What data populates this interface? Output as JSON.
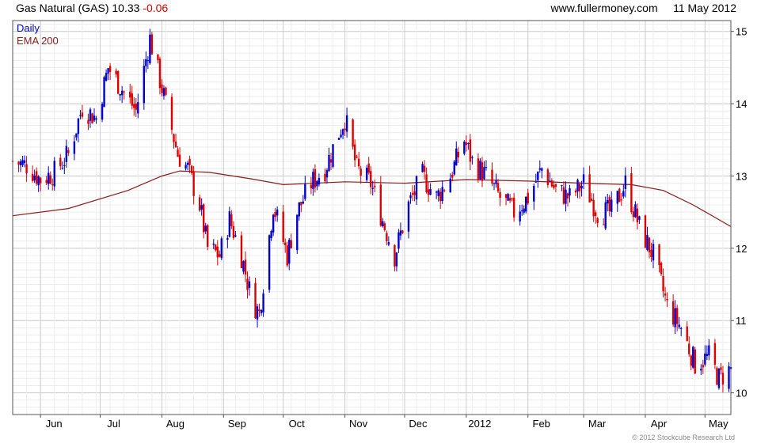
{
  "header": {
    "title": "Gas Natural (GAS)",
    "last_price": "10.33",
    "change": "-0.06",
    "site": "www.fullermoney.com",
    "date": "11 May 2012"
  },
  "copyright": "© 2012 Stockcube Research Ltd",
  "colors": {
    "up": "#0000cc",
    "down": "#dd0000",
    "ema": "#8b1a1a",
    "grid": "#d9d9d9",
    "frame": "#555555"
  },
  "chart_data": {
    "type": "candlestick",
    "legend": [
      "Daily",
      "EMA 200"
    ],
    "legend_position": "top-left",
    "grid": true,
    "y_axis_side": "right",
    "ylim": [
      9.7,
      15.15
    ],
    "yticks": [
      10,
      11,
      12,
      13,
      14,
      15
    ],
    "x_start": "2012-05-18",
    "x_end": "2013-05-14",
    "xticks": [
      {
        "label": "Jun",
        "date": "2012-06-01"
      },
      {
        "label": "Jul",
        "date": "2012-07-01"
      },
      {
        "label": "Aug",
        "date": "2012-08-01"
      },
      {
        "label": "Sep",
        "date": "2012-09-01"
      },
      {
        "label": "Oct",
        "date": "2012-10-01"
      },
      {
        "label": "Nov",
        "date": "2012-11-01"
      },
      {
        "label": "Dec",
        "date": "2012-12-01"
      },
      {
        "label": "2012",
        "date": "2013-01-01"
      },
      {
        "label": "Feb",
        "date": "2013-02-01"
      },
      {
        "label": "Mar",
        "date": "2013-03-01"
      },
      {
        "label": "Apr",
        "date": "2013-04-01"
      },
      {
        "label": "May",
        "date": "2013-05-01"
      }
    ],
    "close_path": [
      [
        "2012-05-18",
        13.2
      ],
      [
        "2012-05-25",
        13.15
      ],
      [
        "2012-06-01",
        12.95
      ],
      [
        "2012-06-08",
        13.05
      ],
      [
        "2012-06-15",
        13.3
      ],
      [
        "2012-06-22",
        13.95
      ],
      [
        "2012-06-29",
        13.8
      ],
      [
        "2012-07-05",
        14.5
      ],
      [
        "2012-07-12",
        14.2
      ],
      [
        "2012-07-19",
        13.9
      ],
      [
        "2012-07-26",
        14.9
      ],
      [
        "2012-08-02",
        14.1
      ],
      [
        "2012-08-09",
        13.3
      ],
      [
        "2012-08-14",
        13.1
      ],
      [
        "2012-08-20",
        12.6
      ],
      [
        "2012-08-24",
        12.0
      ],
      [
        "2012-08-30",
        11.9
      ],
      [
        "2012-09-04",
        12.4
      ],
      [
        "2012-09-10",
        11.9
      ],
      [
        "2012-09-15",
        11.3
      ],
      [
        "2012-09-19",
        11.1
      ],
      [
        "2012-09-26",
        12.6
      ],
      [
        "2012-10-03",
        11.9
      ],
      [
        "2012-10-08",
        12.5
      ],
      [
        "2012-10-15",
        12.9
      ],
      [
        "2012-10-22",
        13.1
      ],
      [
        "2012-10-29",
        13.6
      ],
      [
        "2012-11-01",
        13.8
      ],
      [
        "2012-11-07",
        13.1
      ],
      [
        "2012-11-14",
        12.9
      ],
      [
        "2012-11-21",
        12.3
      ],
      [
        "2012-11-26",
        11.9
      ],
      [
        "2012-12-03",
        12.6
      ],
      [
        "2012-12-10",
        13.0
      ],
      [
        "2012-12-17",
        12.7
      ],
      [
        "2012-12-24",
        13.0
      ],
      [
        "2012-12-31",
        13.5
      ],
      [
        "2013-01-04",
        13.2
      ],
      [
        "2013-01-11",
        13.0
      ],
      [
        "2013-01-18",
        12.7
      ],
      [
        "2013-01-25",
        12.5
      ],
      [
        "2013-02-01",
        12.7
      ],
      [
        "2013-02-08",
        13.1
      ],
      [
        "2013-02-15",
        12.8
      ],
      [
        "2013-02-22",
        12.7
      ],
      [
        "2013-03-01",
        12.9
      ],
      [
        "2013-03-08",
        12.5
      ],
      [
        "2013-03-15",
        12.5
      ],
      [
        "2013-03-22",
        12.9
      ],
      [
        "2013-03-29",
        12.3
      ],
      [
        "2013-04-05",
        11.9
      ],
      [
        "2013-04-12",
        11.2
      ],
      [
        "2013-04-19",
        10.9
      ],
      [
        "2013-04-26",
        10.4
      ],
      [
        "2013-05-03",
        10.5
      ],
      [
        "2013-05-08",
        10.2
      ],
      [
        "2013-05-14",
        10.33
      ]
    ],
    "ema_200": [
      [
        "2012-05-18",
        12.45
      ],
      [
        "2012-06-15",
        12.55
      ],
      [
        "2012-07-15",
        12.8
      ],
      [
        "2012-08-01",
        13.0
      ],
      [
        "2012-08-10",
        13.07
      ],
      [
        "2012-08-25",
        13.05
      ],
      [
        "2012-09-15",
        12.96
      ],
      [
        "2012-10-01",
        12.88
      ],
      [
        "2012-11-01",
        12.92
      ],
      [
        "2012-12-01",
        12.9
      ],
      [
        "2013-01-01",
        12.95
      ],
      [
        "2013-02-01",
        12.93
      ],
      [
        "2013-03-01",
        12.9
      ],
      [
        "2013-03-25",
        12.88
      ],
      [
        "2013-04-10",
        12.8
      ],
      [
        "2013-04-25",
        12.6
      ],
      [
        "2013-05-14",
        12.3
      ]
    ]
  }
}
